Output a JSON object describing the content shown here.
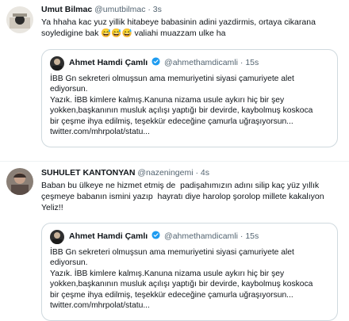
{
  "tweets": [
    {
      "name": "Umut Bilmac",
      "handle": "@umutbilmac",
      "dot": "·",
      "time": "3s",
      "text": "Ya hhaha kac yuz yillik hitabeye babasinin adini yazdirmis, ortaya cikarana\nsoyledigine bak 😅😅😅 valiahi muazzam ulke ha",
      "quote": {
        "name": "Ahmet Hamdi Çamlı",
        "handle": "@ahmethamdicamli",
        "dot": "·",
        "time": "15s",
        "text": "İBB Gn sekreteri olmuşsun ama memuriyetini siyasi çamuriyete alet\nediyorsun.\nYazık. İBB kimlere kalmış.Kanuna nizama usule aykırı hiç bir şey\nyokken,başkanının musluk açılışı yaptığı bir devirde, kaybolmuş koskoca\nbir çeşme ihya edilmiş, teşekkür edeceğine çamurla uğraşıyorsun...\ntwitter.com/mhrpolat/statu..."
      }
    },
    {
      "name": "SUHULET KANTONYAN",
      "handle": "@nazeningemi",
      "dot": "·",
      "time": "4s",
      "text": "Baban bu ülkeye ne hizmet etmiş de  padişahımızın adını silip kaç yüz yıllık\nçeşmeye babanın ismini yazıp  hayratı diye harolop şorolop millete kakalıyon\nYeliz!!",
      "quote": {
        "name": "Ahmet Hamdi Çamlı",
        "handle": "@ahmethamdicamli",
        "dot": "·",
        "time": "15s",
        "text": "İBB Gn sekreteri olmuşsun ama memuriyetini siyasi çamuriyete alet\nediyorsun.\nYazık. İBB kimlere kalmış.Kanuna nizama usule aykırı hiç bir şey\nyokken,başkanının musluk açılışı yaptığı bir devirde, kaybolmuş koskoca\nbir çeşme ihya edilmiş, teşekkür edeceğine çamurla uğraşıyorsun...\ntwitter.com/mhrpolat/statu..."
      }
    }
  ],
  "colors": {
    "verified": "#1d9bf0",
    "secondary": "#536471",
    "border": "#cfd9de"
  }
}
